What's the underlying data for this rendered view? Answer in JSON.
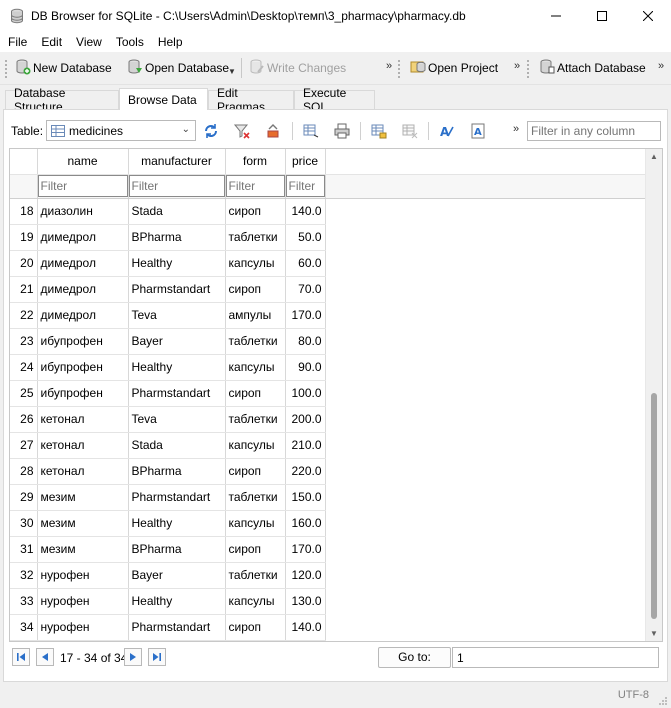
{
  "window": {
    "title": "DB Browser for SQLite - C:\\Users\\Admin\\Desktop\\темп\\3_pharmacy\\pharmacy.db"
  },
  "menu": [
    "File",
    "Edit",
    "View",
    "Tools",
    "Help"
  ],
  "toolbar": {
    "new_database": "New Database",
    "open_database": "Open Database",
    "write_changes": "Write Changes",
    "open_project": "Open Project",
    "attach_database": "Attach Database"
  },
  "tabs": [
    "Database Structure",
    "Browse Data",
    "Edit Pragmas",
    "Execute SQL"
  ],
  "active_tab": "Browse Data",
  "browse": {
    "table_label": "Table:",
    "table_value": "medicines",
    "filter_any_placeholder": "Filter in any column",
    "columns": [
      "name",
      "manufacturer",
      "form",
      "price"
    ],
    "filter_placeholder": "Filter",
    "rows": [
      {
        "id": "18",
        "cells": [
          "диазолин",
          "Stada",
          "сироп",
          "140.0"
        ]
      },
      {
        "id": "19",
        "cells": [
          "димедрол",
          "BPharma",
          "таблетки",
          "50.0"
        ]
      },
      {
        "id": "20",
        "cells": [
          "димедрол",
          "Healthy",
          "капсулы",
          "60.0"
        ]
      },
      {
        "id": "21",
        "cells": [
          "димедрол",
          "Pharmstandart",
          "сироп",
          "70.0"
        ]
      },
      {
        "id": "22",
        "cells": [
          "димедрол",
          "Teva",
          "ампулы",
          "170.0"
        ]
      },
      {
        "id": "23",
        "cells": [
          "ибупрофен",
          "Bayer",
          "таблетки",
          "80.0"
        ]
      },
      {
        "id": "24",
        "cells": [
          "ибупрофен",
          "Healthy",
          "капсулы",
          "90.0"
        ]
      },
      {
        "id": "25",
        "cells": [
          "ибупрофен",
          "Pharmstandart",
          "сироп",
          "100.0"
        ]
      },
      {
        "id": "26",
        "cells": [
          "кетонал",
          "Teva",
          "таблетки",
          "200.0"
        ]
      },
      {
        "id": "27",
        "cells": [
          "кетонал",
          "Stada",
          "капсулы",
          "210.0"
        ]
      },
      {
        "id": "28",
        "cells": [
          "кетонал",
          "BPharma",
          "сироп",
          "220.0"
        ]
      },
      {
        "id": "29",
        "cells": [
          "мезим",
          "Pharmstandart",
          "таблетки",
          "150.0"
        ]
      },
      {
        "id": "30",
        "cells": [
          "мезим",
          "Healthy",
          "капсулы",
          "160.0"
        ]
      },
      {
        "id": "31",
        "cells": [
          "мезим",
          "BPharma",
          "сироп",
          "170.0"
        ]
      },
      {
        "id": "32",
        "cells": [
          "нурофен",
          "Bayer",
          "таблетки",
          "120.0"
        ]
      },
      {
        "id": "33",
        "cells": [
          "нурофен",
          "Healthy",
          "капсулы",
          "130.0"
        ]
      },
      {
        "id": "34",
        "cells": [
          "нурофен",
          "Pharmstandart",
          "сироп",
          "140.0"
        ]
      }
    ]
  },
  "navigation": {
    "record_count": "17 - 34 of 34",
    "goto_label": "Go to:",
    "goto_value": "1"
  },
  "status": {
    "encoding": "UTF-8"
  },
  "colors": {
    "window_bg": "#f0f0f0",
    "panel_bg": "#ffffff",
    "db_icon_blue": "#2a6fc9"
  }
}
